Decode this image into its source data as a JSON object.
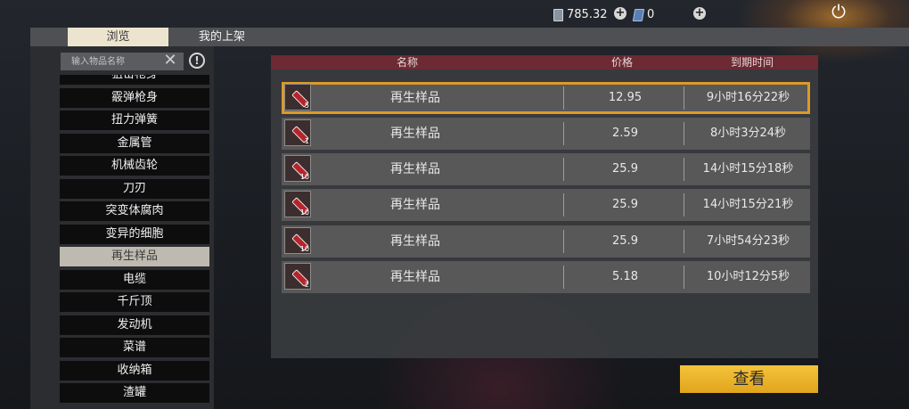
{
  "currency": {
    "scrap_amount": "785.32",
    "scrap_icon": "scrap-coin-icon",
    "crystal_amount": "0",
    "crystal_icon": "crystal-icon"
  },
  "icons": {
    "add": "+",
    "power": "⏻",
    "clear": "✕",
    "help": "!"
  },
  "tabs": [
    {
      "label": "浏览",
      "active": true
    },
    {
      "label": "我的上架",
      "active": false
    }
  ],
  "search": {
    "placeholder": "输入物品名称",
    "value": ""
  },
  "categories": [
    "狙击枪身",
    "霰弹枪身",
    "扭力弹簧",
    "金属管",
    "机械齿轮",
    "刀刃",
    "突变体腐肉",
    "变异的细胞",
    "再生样品",
    "电缆",
    "千斤顶",
    "发动机",
    "菜谱",
    "收纳箱",
    "渣罐"
  ],
  "selected_category": "再生样品",
  "table": {
    "headers": {
      "name": "名称",
      "price": "价格",
      "expiry": "到期时间"
    },
    "rows": [
      {
        "name": "再生样品",
        "count": "5",
        "price": "12.95",
        "expiry": "9小时16分22秒",
        "selected": true
      },
      {
        "name": "再生样品",
        "count": "1",
        "price": "2.59",
        "expiry": "8小时3分24秒"
      },
      {
        "name": "再生样品",
        "count": "10",
        "price": "25.9",
        "expiry": "14小时15分18秒"
      },
      {
        "name": "再生样品",
        "count": "10",
        "price": "25.9",
        "expiry": "14小时15分21秒"
      },
      {
        "name": "再生样品",
        "count": "10",
        "price": "25.9",
        "expiry": "7小时54分23秒"
      },
      {
        "name": "再生样品",
        "count": "2",
        "price": "5.18",
        "expiry": "10小时12分5秒"
      }
    ]
  },
  "view_button": "查看"
}
